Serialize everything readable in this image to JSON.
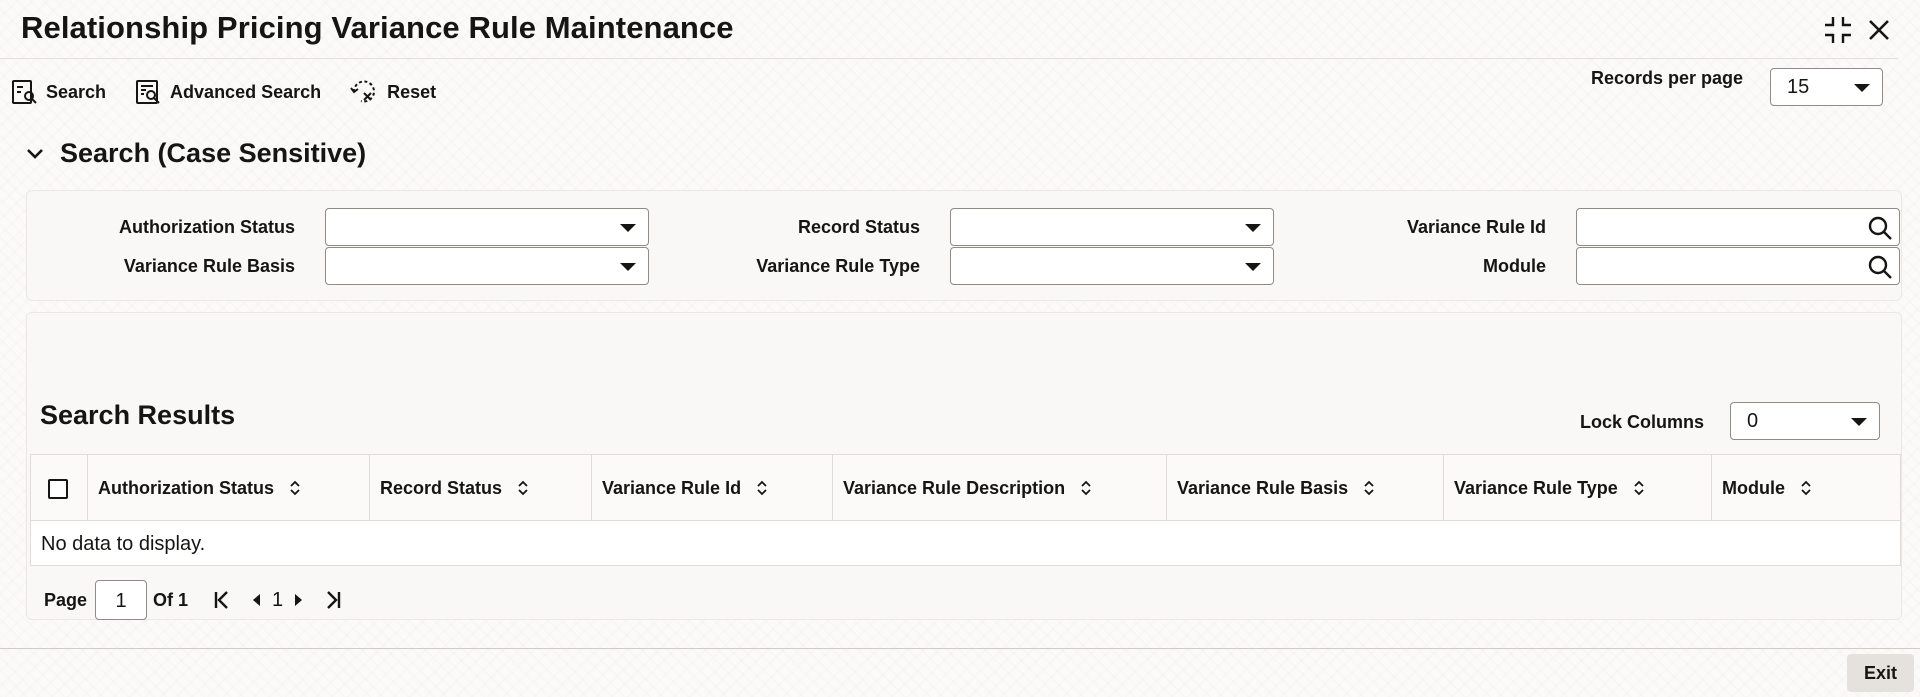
{
  "window": {
    "title": "Relationship Pricing Variance Rule Maintenance",
    "minimize_icon": "collapse-icon",
    "close_icon": "close-icon"
  },
  "toolbar": {
    "search_label": "Search",
    "advanced_search_label": "Advanced Search",
    "reset_label": "Reset",
    "records_per_page_label": "Records per page",
    "records_per_page_value": "15"
  },
  "search_section": {
    "title": "Search (Case Sensitive)",
    "fields": {
      "authorization_status": {
        "label": "Authorization Status",
        "value": ""
      },
      "record_status": {
        "label": "Record Status",
        "value": ""
      },
      "variance_rule_id": {
        "label": "Variance Rule Id",
        "value": ""
      },
      "variance_rule_basis": {
        "label": "Variance Rule Basis",
        "value": ""
      },
      "variance_rule_type": {
        "label": "Variance Rule Type",
        "value": ""
      },
      "module": {
        "label": "Module",
        "value": ""
      }
    }
  },
  "results": {
    "title": "Search Results",
    "lock_columns_label": "Lock Columns",
    "lock_columns_value": "0",
    "columns": [
      "Authorization Status",
      "Record Status",
      "Variance Rule Id",
      "Variance Rule Description",
      "Variance Rule Basis",
      "Variance Rule Type",
      "Module"
    ],
    "rows": [],
    "empty_text": "No data to display."
  },
  "pagination": {
    "page_label": "Page",
    "current_page": "1",
    "of_label": "Of 1",
    "page_number": "1"
  },
  "footer": {
    "exit_label": "Exit"
  },
  "colors": {
    "text": "#161513",
    "border": "#8f8b85",
    "panel": "#f8f7f5",
    "exit_button": "#e5e2dd"
  }
}
